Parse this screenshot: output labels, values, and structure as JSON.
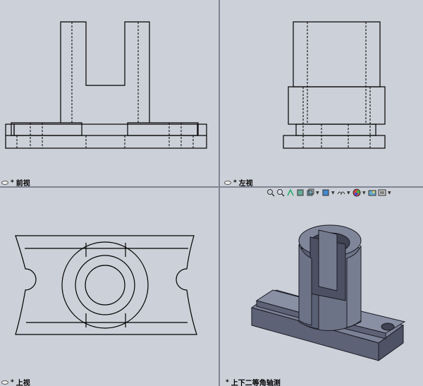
{
  "views": {
    "front": {
      "name": "前视",
      "marker": "*"
    },
    "left": {
      "name": "左视",
      "marker": "*"
    },
    "top": {
      "name": "上视",
      "marker": "*"
    },
    "iso": {
      "name": "上下二等角轴测",
      "marker": "*"
    }
  },
  "toolbar": {
    "icons": [
      "zoom-to-fit-icon",
      "zoom-area-icon",
      "previous-view-icon",
      "section-view-icon",
      "view-orientation-icon",
      "display-style-icon",
      "hide-show-icon",
      "appearance-icon",
      "scene-icon",
      "view-settings-icon"
    ]
  },
  "colors": {
    "background": "#ccd0d8",
    "line": "#000000",
    "model": "#6d7387",
    "divider": "#7f8593"
  }
}
